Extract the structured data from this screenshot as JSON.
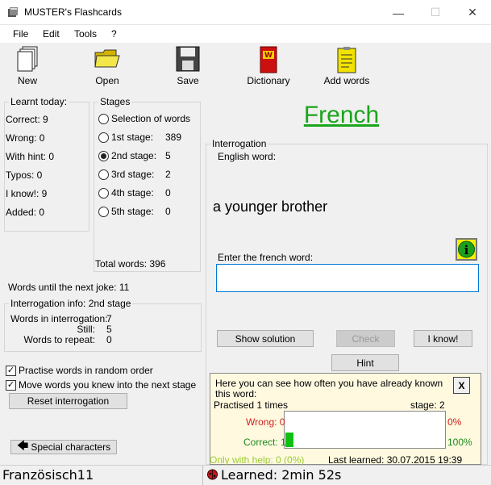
{
  "window": {
    "title": "MUSTER's Flashcards",
    "minimize": "—",
    "maximize": "☐",
    "close": "✕"
  },
  "menu": [
    "File",
    "Edit",
    "Tools",
    "?"
  ],
  "toolbar": {
    "new": "New",
    "open": "Open",
    "save": "Save",
    "dictionary": "Dictionary",
    "add_words": "Add words"
  },
  "learnt_today": {
    "label": "Learnt today:",
    "items": [
      "Correct: 9",
      "Wrong: 0",
      "With hint: 0",
      "Typos: 0",
      "I know!: 9",
      "Added: 0"
    ]
  },
  "stages": {
    "label": "Stages",
    "items": [
      {
        "label": "Selection of words",
        "count": ""
      },
      {
        "label": "1st stage:",
        "count": "389"
      },
      {
        "label": "2nd stage:",
        "count": "5"
      },
      {
        "label": "3rd stage:",
        "count": "2"
      },
      {
        "label": "4th stage:",
        "count": "0"
      },
      {
        "label": "5th stage:",
        "count": "0"
      }
    ],
    "selected_index": 2,
    "total": "Total words: 396"
  },
  "joke": "Words until the next joke: 11",
  "interrogation_info": {
    "label": "Interrogation info: 2nd stage",
    "rows": [
      {
        "label": "Words in interrogation:",
        "value": "7"
      },
      {
        "label": "Still:",
        "value": "5"
      },
      {
        "label": "Words to repeat:",
        "value": "0"
      }
    ]
  },
  "options": {
    "random": "Practise words in random order",
    "move_known": "Move words you knew into the next stage",
    "reset": "Reset interrogation",
    "special_chars": "Special characters"
  },
  "language": "French",
  "interrogation": {
    "label": "Interrogation",
    "source_label": "English word:",
    "word": "a younger brother",
    "input_label": "Enter the french word:",
    "input_value": "",
    "show_solution": "Show solution",
    "check": "Check",
    "i_know": "I know!",
    "hint": "Hint"
  },
  "stats": {
    "intro": "Here you can see how often you have already known this word:",
    "practised": "Practised 1 times",
    "stage": "stage: 2",
    "wrong_label": "Wrong: 0",
    "wrong_pct": "0%",
    "wrong_fraction": 0,
    "correct_label": "Correct: 1",
    "correct_pct": "100%",
    "correct_fraction": 1,
    "help": "Only with help: 0 (0%)",
    "last_learned": "Last learned: 30.07.2015 19:39",
    "close": "X"
  },
  "status": {
    "file": "Französisch11",
    "learned": "Learned: 2min 52s"
  },
  "colors": {
    "accent": "#1aa51a",
    "wrong": "#d02020",
    "correct": "#1a8a1a",
    "help": "#9acd32"
  }
}
